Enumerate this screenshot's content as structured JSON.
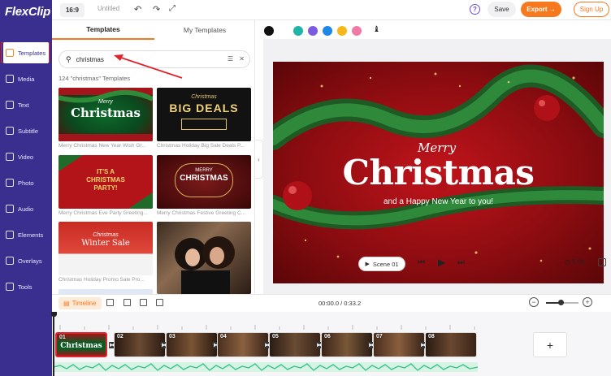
{
  "app": {
    "logo": "FlexClip"
  },
  "sidebar": {
    "items": [
      {
        "label": "Templates",
        "icon": "layers-icon",
        "active": true
      },
      {
        "label": "Media",
        "icon": "folder-icon"
      },
      {
        "label": "Text",
        "icon": "text-icon"
      },
      {
        "label": "Subtitle",
        "icon": "subtitle-icon"
      },
      {
        "label": "Video",
        "icon": "video-icon"
      },
      {
        "label": "Photo",
        "icon": "photo-icon"
      },
      {
        "label": "Audio",
        "icon": "audio-icon"
      },
      {
        "label": "Elements",
        "icon": "elements-icon"
      },
      {
        "label": "Overlays",
        "icon": "overlays-icon"
      },
      {
        "label": "Tools",
        "icon": "tools-icon"
      }
    ]
  },
  "topbar": {
    "ratio": "16:9",
    "title": "Untitled",
    "help": "?",
    "save": "Save",
    "export": "Export →",
    "signup": "Sign Up"
  },
  "panel": {
    "tabs": {
      "templates": "Templates",
      "my_templates": "My Templates"
    },
    "search_value": "christmas",
    "result_count": "124 \"christmas\" Templates",
    "templates": [
      {
        "caption": "Merry Christmas New Year Wish Gr...",
        "title": "Christmas",
        "sub": "Merry"
      },
      {
        "caption": "Christmas Holiday Big Sale Deals P...",
        "title": "BIG DEALS",
        "sub": "Christmas"
      },
      {
        "caption": "Merry Christmas Eve Party Greeting...",
        "title": "IT'S A CHRISTMAS PARTY!",
        "sub": ""
      },
      {
        "caption": "Merry Christmas Festive Greeting C...",
        "title": "CHRISTMAS",
        "sub": "MERRY"
      },
      {
        "caption": "Christmas Holiday Promo Sale Pro...",
        "title": "Winter Sale",
        "sub": "Christmas"
      },
      {
        "caption": "",
        "title": "",
        "sub": ""
      }
    ]
  },
  "colors": [
    "#111111",
    "#1fb5a8",
    "#7b5ce0",
    "#1e88e5",
    "#f6b71a",
    "#f07aa4"
  ],
  "canvas": {
    "script_line": "Merry",
    "title": "Christmas",
    "subtitle": "and a Happy New Year to you!",
    "scene_label": "Scene 01",
    "duration": "5.0s"
  },
  "timeline": {
    "label": "Timeline",
    "time": "00:00.0 / 0:33.2",
    "zoom_level": 0.45,
    "clips": [
      {
        "num": "01",
        "text": "Christmas"
      },
      {
        "num": "02",
        "text": ""
      },
      {
        "num": "03",
        "text": ""
      },
      {
        "num": "04",
        "text": ""
      },
      {
        "num": "05",
        "text": ""
      },
      {
        "num": "06",
        "text": ""
      },
      {
        "num": "07",
        "text": ""
      },
      {
        "num": "08",
        "text": ""
      }
    ],
    "add": "+"
  }
}
